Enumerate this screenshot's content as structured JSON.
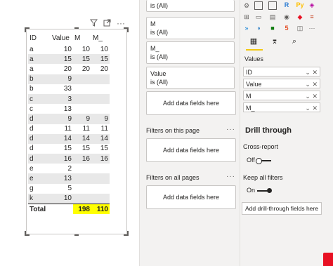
{
  "matrix": {
    "columns": [
      "ID",
      "Value",
      "M",
      "M_"
    ],
    "rows": [
      [
        "a",
        "10",
        "10",
        "10"
      ],
      [
        "a",
        "15",
        "15",
        "15"
      ],
      [
        "a",
        "20",
        "20",
        "20"
      ],
      [
        "b",
        "9",
        "",
        ""
      ],
      [
        "b",
        "33",
        "",
        ""
      ],
      [
        "c",
        "3",
        "",
        ""
      ],
      [
        "c",
        "13",
        "",
        ""
      ],
      [
        "d",
        "9",
        "9",
        "9"
      ],
      [
        "d",
        "11",
        "11",
        "11"
      ],
      [
        "d",
        "14",
        "14",
        "14"
      ],
      [
        "d",
        "15",
        "15",
        "15"
      ],
      [
        "d",
        "16",
        "16",
        "16"
      ],
      [
        "e",
        "2",
        "",
        ""
      ],
      [
        "e",
        "13",
        "",
        ""
      ],
      [
        "g",
        "5",
        "",
        ""
      ],
      [
        "k",
        "10",
        "",
        ""
      ]
    ],
    "total": {
      "label": "Total",
      "value": "",
      "m": "198",
      "m_": "110"
    },
    "highlight_color": "#ffff00"
  },
  "filters": {
    "cards": [
      {
        "field": "",
        "state": "is (All)"
      },
      {
        "field": "M",
        "state": "is (All)"
      },
      {
        "field": "M_",
        "state": "is (All)"
      },
      {
        "field": "Value",
        "state": "is (All)"
      }
    ],
    "add_fields_label": "Add data fields here",
    "on_this_page": "Filters on this page",
    "add_fields_label_2": "Add data fields here",
    "on_all_pages": "Filters on all pages",
    "add_fields_label_3": "Add data fields here",
    "more": "···"
  },
  "viz": {
    "values_title": "Values",
    "wells": [
      "ID",
      "Value",
      "M",
      "M_"
    ],
    "drill_title": "Drill through",
    "cross_report": "Cross-report",
    "cross_report_state": "Off",
    "keep_filters": "Keep all filters",
    "keep_filters_state": "On",
    "add_drill": "Add drill-through fields here",
    "accent_color": "#f2c811"
  }
}
